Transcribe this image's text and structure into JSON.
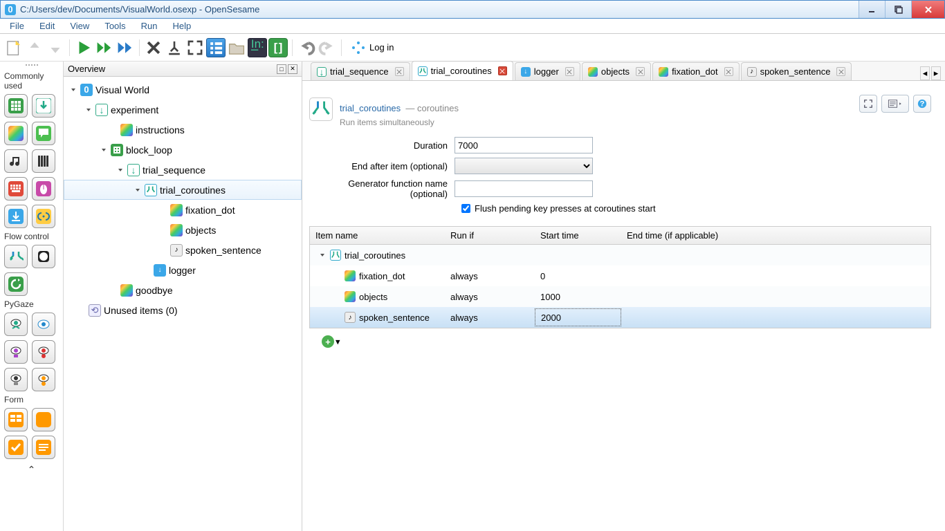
{
  "window": {
    "title": "C:/Users/dev/Documents/VisualWorld.osexp - OpenSesame"
  },
  "menus": [
    "File",
    "Edit",
    "View",
    "Tools",
    "Run",
    "Help"
  ],
  "toolbar": {
    "login": "Log in"
  },
  "palette": {
    "sections": [
      {
        "title": "Commonly used"
      },
      {
        "title": "Flow control"
      },
      {
        "title": "PyGaze"
      },
      {
        "title": "Form"
      }
    ]
  },
  "overview": {
    "title": "Overview",
    "tree": {
      "root": "Visual World",
      "experiment": "experiment",
      "instructions": "instructions",
      "block_loop": "block_loop",
      "trial_sequence": "trial_sequence",
      "trial_coroutines": "trial_coroutines",
      "fixation_dot": "fixation_dot",
      "objects": "objects",
      "spoken_sentence": "spoken_sentence",
      "logger": "logger",
      "goodbye": "goodbye",
      "unused": "Unused items (0)"
    }
  },
  "tabs": [
    {
      "label": "trial_sequence",
      "icon": "seq"
    },
    {
      "label": "trial_coroutines",
      "icon": "cor",
      "active": true,
      "close_red": true
    },
    {
      "label": "logger",
      "icon": "log"
    },
    {
      "label": "objects",
      "icon": "rainbow"
    },
    {
      "label": "fixation_dot",
      "icon": "rainbow"
    },
    {
      "label": "spoken_sentence",
      "icon": "samp"
    }
  ],
  "editor": {
    "title": "trial_coroutines",
    "type": "coroutines",
    "subtitle": "Run items simultaneously",
    "fields": {
      "duration_label": "Duration",
      "duration_value": "7000",
      "end_after_label": "End after item (optional)",
      "end_after_value": "",
      "gen_label": "Generator function name (optional)",
      "gen_value": "",
      "flush_label": "Flush pending key presses at coroutines start",
      "flush_checked": true
    },
    "table": {
      "headers": {
        "name": "Item name",
        "runif": "Run if",
        "start": "Start time",
        "end": "End time (if applicable)"
      },
      "parent": "trial_coroutines",
      "rows": [
        {
          "name": "fixation_dot",
          "runif": "always",
          "start": "0",
          "end": "",
          "icon": "rainbow"
        },
        {
          "name": "objects",
          "runif": "always",
          "start": "1000",
          "end": "",
          "icon": "rainbow"
        },
        {
          "name": "spoken_sentence",
          "runif": "always",
          "start": "2000",
          "end": "",
          "icon": "samp",
          "selected": true
        }
      ]
    }
  }
}
